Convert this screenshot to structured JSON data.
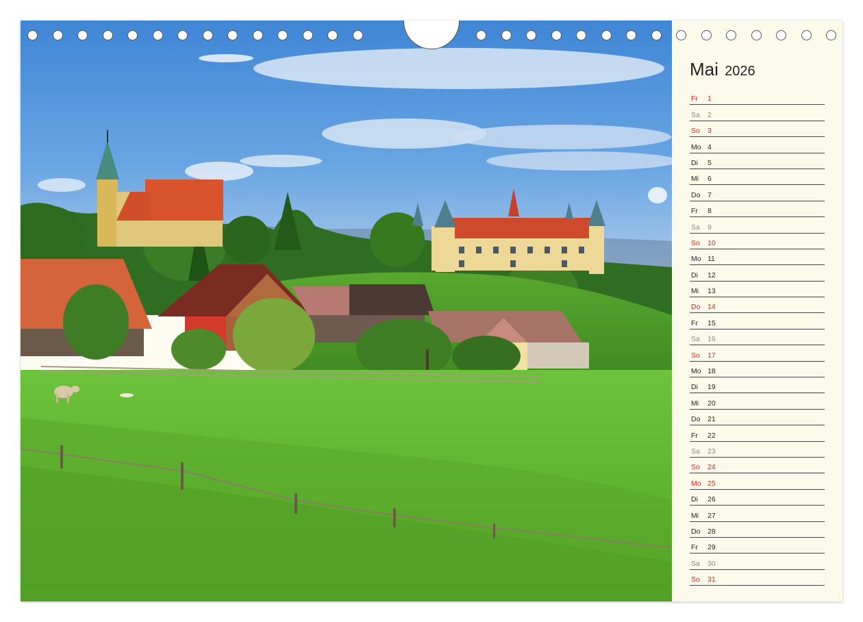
{
  "calendar": {
    "month": "Mai",
    "year": "2026",
    "colors": {
      "weekday": "#222222",
      "saturday": "#888888",
      "sunday_holiday": "#d0281e"
    },
    "days": [
      {
        "wd": "Fr",
        "d": "1",
        "type": "red"
      },
      {
        "wd": "Sa",
        "d": "2",
        "type": "sat"
      },
      {
        "wd": "So",
        "d": "3",
        "type": "red"
      },
      {
        "wd": "Mo",
        "d": "4",
        "type": "normal"
      },
      {
        "wd": "Di",
        "d": "5",
        "type": "normal"
      },
      {
        "wd": "Mi",
        "d": "6",
        "type": "normal"
      },
      {
        "wd": "Do",
        "d": "7",
        "type": "normal"
      },
      {
        "wd": "Fr",
        "d": "8",
        "type": "normal"
      },
      {
        "wd": "Sa",
        "d": "9",
        "type": "sat"
      },
      {
        "wd": "So",
        "d": "10",
        "type": "red"
      },
      {
        "wd": "Mo",
        "d": "11",
        "type": "normal"
      },
      {
        "wd": "Di",
        "d": "12",
        "type": "normal"
      },
      {
        "wd": "Mi",
        "d": "13",
        "type": "normal"
      },
      {
        "wd": "Do",
        "d": "14",
        "type": "red"
      },
      {
        "wd": "Fr",
        "d": "15",
        "type": "normal"
      },
      {
        "wd": "Sa",
        "d": "16",
        "type": "sat"
      },
      {
        "wd": "So",
        "d": "17",
        "type": "red"
      },
      {
        "wd": "Mo",
        "d": "18",
        "type": "normal"
      },
      {
        "wd": "Di",
        "d": "19",
        "type": "normal"
      },
      {
        "wd": "Mi",
        "d": "20",
        "type": "normal"
      },
      {
        "wd": "Do",
        "d": "21",
        "type": "normal"
      },
      {
        "wd": "Fr",
        "d": "22",
        "type": "normal"
      },
      {
        "wd": "Sa",
        "d": "23",
        "type": "sat"
      },
      {
        "wd": "So",
        "d": "24",
        "type": "red"
      },
      {
        "wd": "Mo",
        "d": "25",
        "type": "red"
      },
      {
        "wd": "Di",
        "d": "26",
        "type": "normal"
      },
      {
        "wd": "Mi",
        "d": "27",
        "type": "normal"
      },
      {
        "wd": "Do",
        "d": "28",
        "type": "normal"
      },
      {
        "wd": "Fr",
        "d": "29",
        "type": "normal"
      },
      {
        "wd": "Sa",
        "d": "30",
        "type": "sat"
      },
      {
        "wd": "So",
        "d": "31",
        "type": "red"
      }
    ]
  }
}
